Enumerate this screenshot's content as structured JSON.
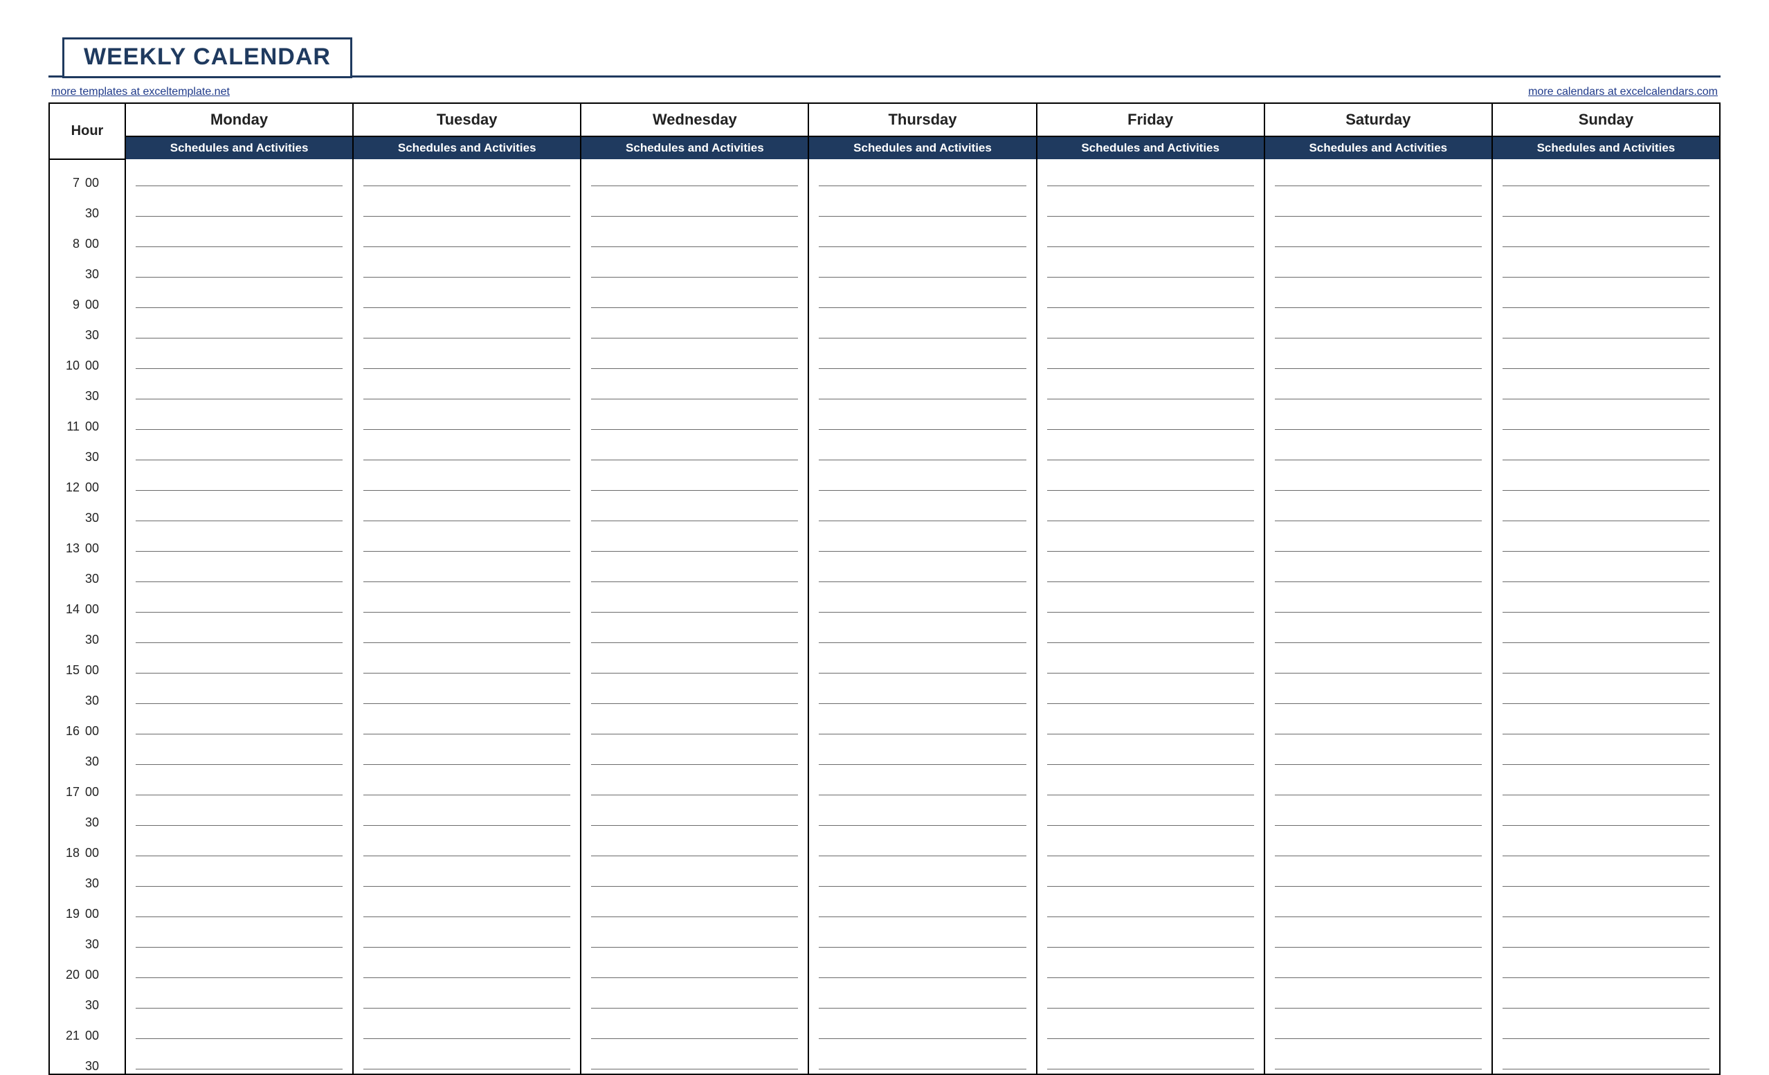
{
  "title": "WEEKLY CALENDAR",
  "links": {
    "left": "more templates at exceltemplate.net",
    "right": "more calendars at excelcalendars.com"
  },
  "hour_header": "Hour",
  "day_subheader": "Schedules and Activities",
  "days": [
    "Monday",
    "Tuesday",
    "Wednesday",
    "Thursday",
    "Friday",
    "Saturday",
    "Sunday"
  ],
  "time_rows": [
    {
      "hour": "7",
      "min": "00"
    },
    {
      "hour": "",
      "min": "30"
    },
    {
      "hour": "8",
      "min": "00"
    },
    {
      "hour": "",
      "min": "30"
    },
    {
      "hour": "9",
      "min": "00"
    },
    {
      "hour": "",
      "min": "30"
    },
    {
      "hour": "10",
      "min": "00"
    },
    {
      "hour": "",
      "min": "30"
    },
    {
      "hour": "11",
      "min": "00"
    },
    {
      "hour": "",
      "min": "30"
    },
    {
      "hour": "12",
      "min": "00"
    },
    {
      "hour": "",
      "min": "30"
    },
    {
      "hour": "13",
      "min": "00"
    },
    {
      "hour": "",
      "min": "30"
    },
    {
      "hour": "14",
      "min": "00"
    },
    {
      "hour": "",
      "min": "30"
    },
    {
      "hour": "15",
      "min": "00"
    },
    {
      "hour": "",
      "min": "30"
    },
    {
      "hour": "16",
      "min": "00"
    },
    {
      "hour": "",
      "min": "30"
    },
    {
      "hour": "17",
      "min": "00"
    },
    {
      "hour": "",
      "min": "30"
    },
    {
      "hour": "18",
      "min": "00"
    },
    {
      "hour": "",
      "min": "30"
    },
    {
      "hour": "19",
      "min": "00"
    },
    {
      "hour": "",
      "min": "30"
    },
    {
      "hour": "20",
      "min": "00"
    },
    {
      "hour": "",
      "min": "30"
    },
    {
      "hour": "21",
      "min": "00"
    },
    {
      "hour": "",
      "min": "30"
    }
  ]
}
